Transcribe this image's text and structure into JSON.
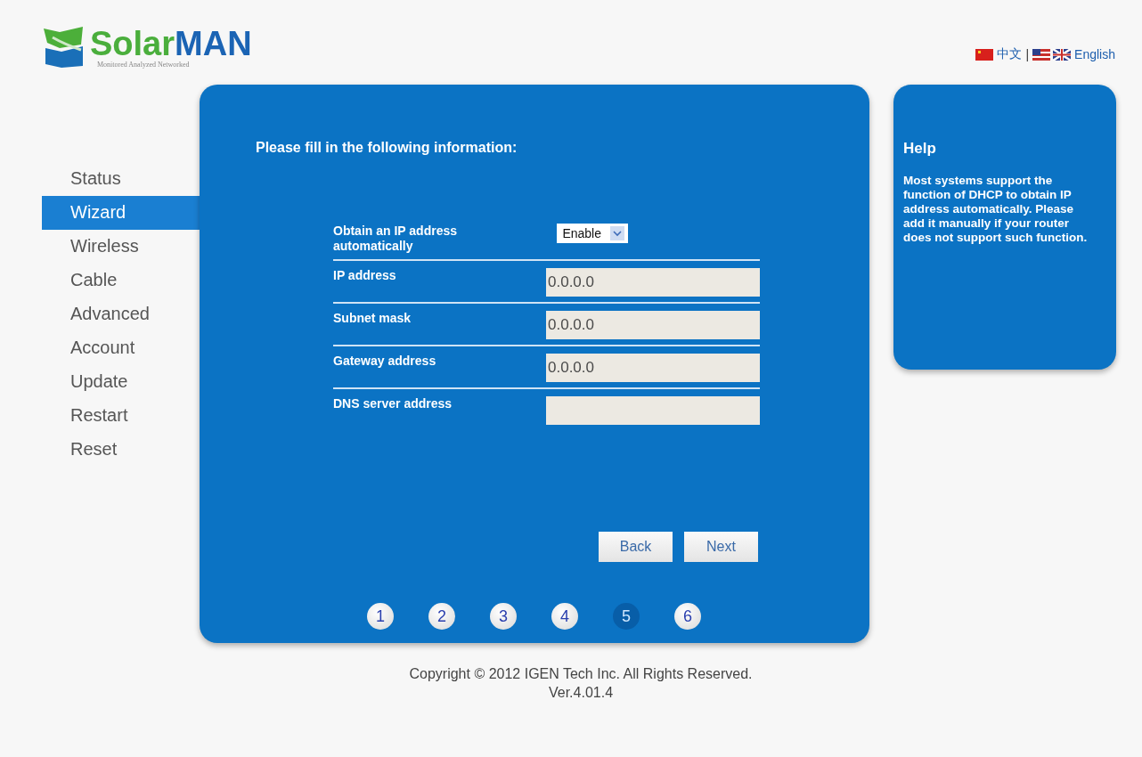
{
  "logo": {
    "text_1": "Solar",
    "text_2": "MAN",
    "tagline": "Monitored Analyzed Networked"
  },
  "languages": [
    {
      "label": "中文",
      "kind": "chinese"
    },
    {
      "label": "English",
      "kind": "english"
    }
  ],
  "language_separator": "|",
  "sidebar": {
    "items": [
      {
        "label": "Status",
        "selected": false
      },
      {
        "label": "Wizard",
        "selected": true
      },
      {
        "label": "Wireless",
        "selected": false
      },
      {
        "label": "Cable",
        "selected": false
      },
      {
        "label": "Advanced",
        "selected": false
      },
      {
        "label": "Account",
        "selected": false
      },
      {
        "label": "Update",
        "selected": false
      },
      {
        "label": "Restart",
        "selected": false
      },
      {
        "label": "Reset",
        "selected": false
      }
    ]
  },
  "wizard": {
    "title": "Please fill in the following information:",
    "rows": [
      {
        "kind": "select",
        "label": "Obtain an IP address automatically",
        "value": "Enable"
      },
      {
        "kind": "input",
        "label": "IP address",
        "value": "0.0.0.0",
        "disabled": true
      },
      {
        "kind": "input",
        "label": "Subnet mask",
        "value": "0.0.0.0",
        "disabled": true
      },
      {
        "kind": "input",
        "label": "Gateway address",
        "value": "0.0.0.0",
        "disabled": true
      },
      {
        "kind": "input",
        "label": "DNS server address",
        "disabled": true
      }
    ],
    "buttons": [
      "Back",
      "Next"
    ],
    "steps": [
      {
        "label": "1",
        "selected": false
      },
      {
        "label": "2",
        "selected": false
      },
      {
        "label": "3",
        "selected": false
      },
      {
        "label": "4",
        "selected": false
      },
      {
        "label": "5",
        "selected": true
      },
      {
        "label": "6",
        "selected": false
      }
    ]
  },
  "help": {
    "title": "Help",
    "text": "Most systems support the function of DHCP to obtain IP address automatically. Please add it manually if your router does not support such function."
  },
  "footer": {
    "copyright": "Copyright © 2012 IGEN Tech Inc. All Rights Reserved.",
    "version": "Ver.4.01.4"
  }
}
